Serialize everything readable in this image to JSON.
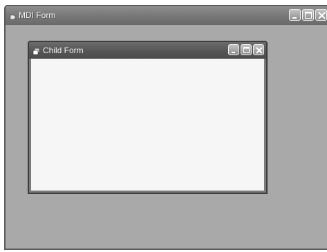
{
  "mdi_form": {
    "title": "MDI Form",
    "icon": "form-icon",
    "buttons": [
      "minimize-button",
      "maximize-button",
      "close-button"
    ]
  },
  "child_form": {
    "title": "Child Form",
    "icon": "child-form-icon",
    "buttons": [
      "minimize-button",
      "maximize-button",
      "close-button"
    ]
  },
  "colors": {
    "mdi_client": "#a9a9a9",
    "child_client": "#f6f6f6",
    "title_text": "#f2f2f2"
  }
}
